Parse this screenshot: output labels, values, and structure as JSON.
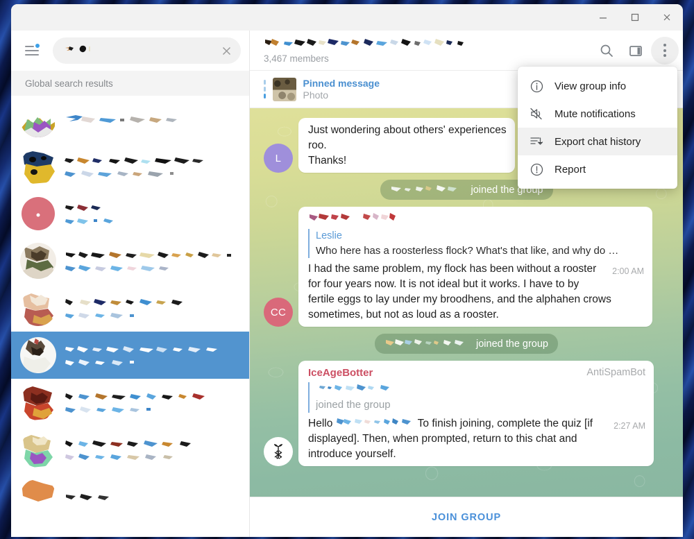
{
  "window": {
    "controls": {
      "minimize": "minimize-button",
      "maximize": "maximize-button",
      "close": "close-button"
    }
  },
  "sidebar": {
    "search": {
      "value": "",
      "placeholder": "",
      "clear_label": "clear-search"
    },
    "menu_badge": true,
    "section_header": "Global search results",
    "results": [
      {
        "id": 1,
        "redacted": true,
        "selected": false
      },
      {
        "id": 2,
        "redacted": true,
        "selected": false
      },
      {
        "id": 3,
        "redacted": true,
        "selected": false
      },
      {
        "id": 4,
        "redacted": true,
        "selected": false
      },
      {
        "id": 5,
        "redacted": true,
        "selected": false
      },
      {
        "id": 6,
        "redacted": true,
        "selected": true
      },
      {
        "id": 7,
        "redacted": true,
        "selected": false
      },
      {
        "id": 8,
        "redacted": true,
        "selected": false
      },
      {
        "id": 9,
        "redacted": true,
        "selected": false
      }
    ]
  },
  "chat_header": {
    "title_redacted": true,
    "members": "3,467 members",
    "icons": {
      "search": "search-icon",
      "panel": "right-panel-icon",
      "more": "more-options-icon"
    }
  },
  "pinned": {
    "title": "Pinned message",
    "subtitle": "Photo"
  },
  "menu": {
    "items": [
      {
        "label": "View group info",
        "icon": "info-icon",
        "highlighted": false
      },
      {
        "label": "Mute notifications",
        "icon": "mute-icon",
        "highlighted": false
      },
      {
        "label": "Export chat history",
        "icon": "export-icon",
        "highlighted": true
      },
      {
        "label": "Report",
        "icon": "report-icon",
        "highlighted": false
      }
    ]
  },
  "messages": [
    {
      "type": "message",
      "avatar": {
        "initials": "L",
        "color": "#9f8fdb"
      },
      "text_lines": [
        "Just wondering about others' experiences",
        "roo.",
        "Thanks!"
      ],
      "truncated": true
    },
    {
      "type": "service",
      "name_redacted": true,
      "text": "joined the group"
    },
    {
      "type": "message",
      "avatar": {
        "initials": "CC",
        "color": "#d9697a"
      },
      "sender_redacted": true,
      "reply": {
        "name": "Leslie",
        "text": "Who here has a roosterless flock? What's that like, and why do …"
      },
      "text": "I had the same problem, my flock has been without a rooster for four years now. It is not ideal but it works. I have to by fertile eggs to lay under my broodhens, and the alphahen crows sometimes, but not as loud as a rooster.",
      "time": "2:00 AM"
    },
    {
      "type": "service",
      "name_redacted": true,
      "text": "joined the group"
    },
    {
      "type": "message",
      "avatar": {
        "initials": "",
        "color": "#ffffff",
        "bot": true,
        "glyph": "❄"
      },
      "sender": "IceAgeBotter",
      "sender_color": "#cc4f63",
      "via": "AntiSpamBot",
      "reply": {
        "name_redacted": true,
        "text": "joined the group"
      },
      "text_prefix": "Hello ",
      "text": "To finish joining, complete the quiz [if displayed]. Then, when prompted, return to this chat and introduce yourself.",
      "time": "2:27 AM"
    }
  ],
  "footer": {
    "join_label": "JOIN GROUP"
  },
  "colors": {
    "accent_blue": "#4a90d9",
    "selected_row": "#5294cf",
    "bot_name": "#cc4f63",
    "reply_blue": "#5a9ad6",
    "service_bg": "rgba(73,112,72,.34)"
  }
}
